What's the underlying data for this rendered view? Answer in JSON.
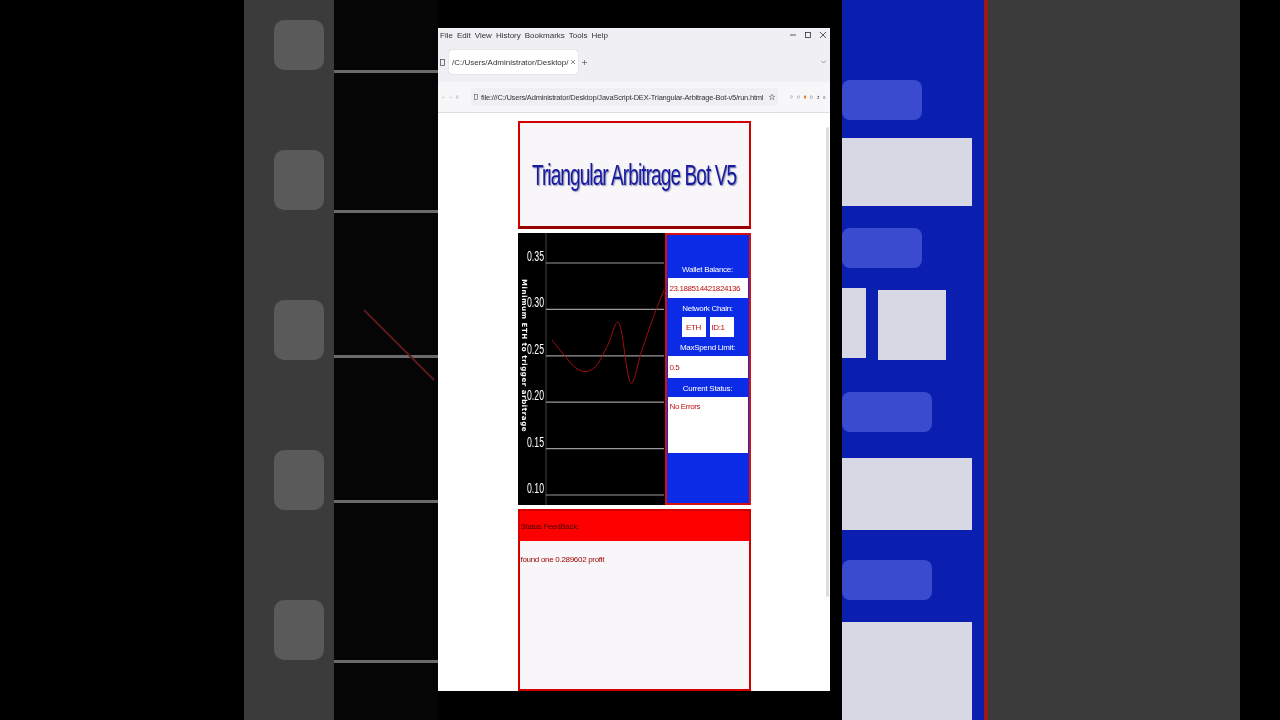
{
  "browser": {
    "menu": [
      "File",
      "Edit",
      "View",
      "History",
      "Bookmarks",
      "Tools",
      "Help"
    ],
    "tab": {
      "title": "/C:/Users/Administrator/Desktop/"
    },
    "address": "file:///C:/Users/Administrator/Desktop/JavaScript-DEX-Triangular-Arbitrage-Bot-v5/run.html"
  },
  "page": {
    "title": "Triangular Arbitrage Bot V5",
    "chart": {
      "chart_data": {
        "type": "line",
        "ylabel": "Minimum ETH to trigger arbitrage",
        "ylim": [
          0.1,
          0.35
        ],
        "grid": true,
        "yticks": [
          0.35,
          {
            "value": 0.3,
            "label": "0.30"
          },
          0.25,
          {
            "value": 0.2,
            "label": "0.20"
          },
          0.15,
          {
            "value": 0.1,
            "label": "0.10"
          }
        ],
        "series": [
          {
            "color": "#a01010",
            "values": [
              0.267,
              0.252,
              0.238,
              0.233,
              0.24,
              0.262,
              0.285,
              0.221,
              0.255,
              0.29,
              0.321
            ]
          }
        ]
      }
    },
    "panel": {
      "wallet_balance_label": "Wallet Balance:",
      "wallet_balance": "23.188514421824136",
      "network_chain_label": "Network Chain:",
      "network": "ETH",
      "chain_id": "ID:1",
      "max_spend_label": "MaxSpend Limit:",
      "max_spend": "0.5",
      "current_status_label": "Current Status:",
      "current_status": "No Errors"
    },
    "status_feedback": {
      "heading": "Status FeedBack:",
      "message": "found one 0.289602 profit"
    }
  }
}
